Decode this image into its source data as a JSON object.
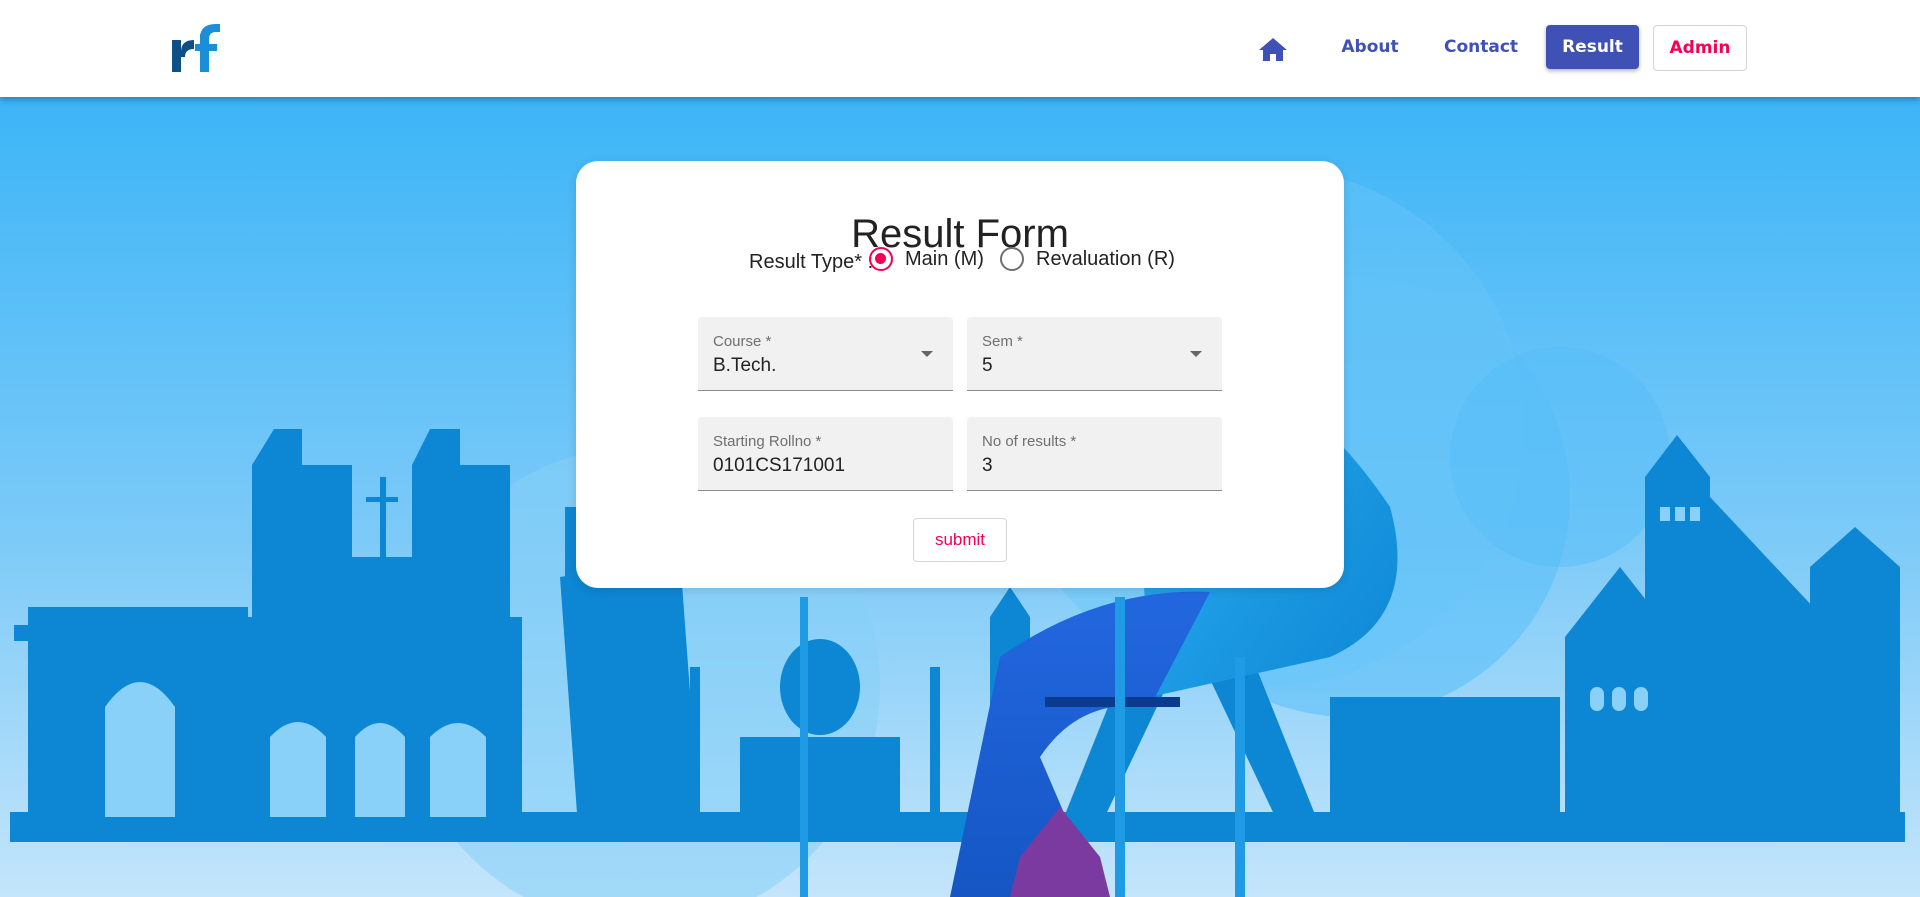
{
  "header": {
    "logo_text": "rf",
    "nav": {
      "about": "About",
      "contact": "Contact",
      "result": "Result",
      "admin": "Admin"
    }
  },
  "form": {
    "title": "Result Form",
    "result_type_label": "Result Type* :",
    "options": [
      {
        "label": "Main (M)",
        "selected": true
      },
      {
        "label": "Revaluation (R)",
        "selected": false
      }
    ],
    "course": {
      "label": "Course *",
      "value": "B.Tech."
    },
    "sem": {
      "label": "Sem *",
      "value": "5"
    },
    "starting_rollno": {
      "label": "Starting Rollno *",
      "value": "0101CS171001"
    },
    "no_of_results": {
      "label": "No of results *",
      "value": "3"
    },
    "submit_label": "submit"
  },
  "colors": {
    "primary": "#3f51b5",
    "accent": "#f50057",
    "sky": "#42b6f6",
    "skyline": "#0d86d3"
  },
  "icons": [
    "home-icon",
    "dropdown-arrow-icon"
  ]
}
